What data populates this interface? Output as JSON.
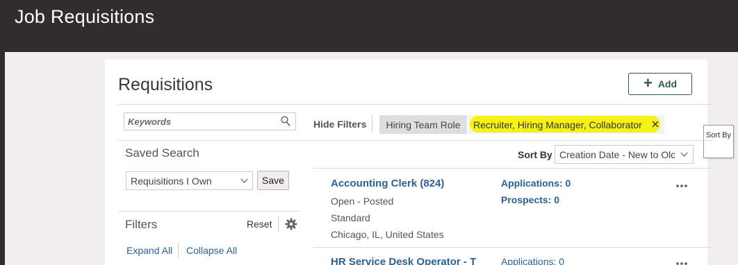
{
  "header": {
    "title": "Job Requisitions"
  },
  "page": {
    "title": "Requisitions",
    "add_label": "Add"
  },
  "search": {
    "placeholder": "Keywords"
  },
  "filter_bar": {
    "hide_filters_label": "Hide Filters",
    "chip": {
      "label": "Hiring Team Role",
      "value": "Recruiter, Hiring Manager, Collaborator"
    }
  },
  "tooltip": {
    "text": "Sort By"
  },
  "saved_search": {
    "label": "Saved Search",
    "selected": "Requisitions I Own",
    "save_label": "Save"
  },
  "filters": {
    "label": "Filters",
    "reset_label": "Reset",
    "expand_all_label": "Expand All",
    "collapse_all_label": "Collapse All"
  },
  "sort": {
    "label": "Sort By",
    "selected": "Creation Date - New to Old"
  },
  "requisitions": [
    {
      "title": "Accounting Clerk (824)",
      "status": "Open - Posted",
      "type": "Standard",
      "location": "Chicago, IL, United States",
      "applications": "Applications: 0",
      "prospects": "Prospects: 0"
    },
    {
      "title": "HR Service Desk Operator - T",
      "applications": "Applications: 0"
    }
  ],
  "colors": {
    "header_bg": "#312d2a",
    "link": "#2a6296",
    "accent_green": "#2f5e45",
    "highlight": "#f5f10a"
  }
}
